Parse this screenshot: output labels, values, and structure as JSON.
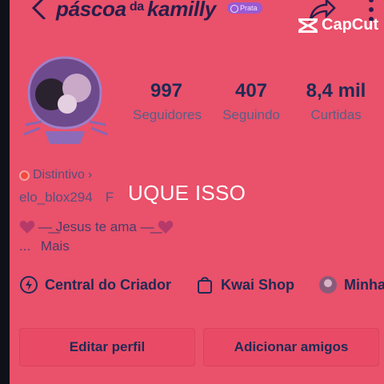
{
  "header": {
    "title_part1": "páscoa",
    "title_small": "da",
    "title_part2": "kamilly",
    "badge": "Prata"
  },
  "watermark": {
    "label": "CapCut"
  },
  "stats": [
    {
      "value": "997",
      "label": "Seguidores"
    },
    {
      "value": "407",
      "label": "Seguindo"
    },
    {
      "value": "8,4 mil",
      "label": "Curtidas"
    }
  ],
  "profile": {
    "distintivo": "Distintivo",
    "distintivo_chevron": "›",
    "username": "elo_blox294",
    "username_extra": "F",
    "bio_line1": "—͟ Jesus te ama —͟",
    "bio_line2_prefix": "...",
    "bio_more": "Mais"
  },
  "overlay_text": "UQUE ISSO",
  "shortcuts": [
    {
      "label": "Central do Criador",
      "icon": "creator-center-icon"
    },
    {
      "label": "Kwai Shop",
      "icon": "shopping-bag-icon"
    },
    {
      "label": "Minha",
      "icon": "avatar-icon"
    }
  ],
  "actions": {
    "edit_profile": "Editar perfil",
    "add_friends": "Adicionar amigos"
  },
  "colors": {
    "background": "#e9506a",
    "text_dark": "#1f2a55",
    "text_muted": "#5a5f86",
    "badge": "#9a5ad0"
  }
}
